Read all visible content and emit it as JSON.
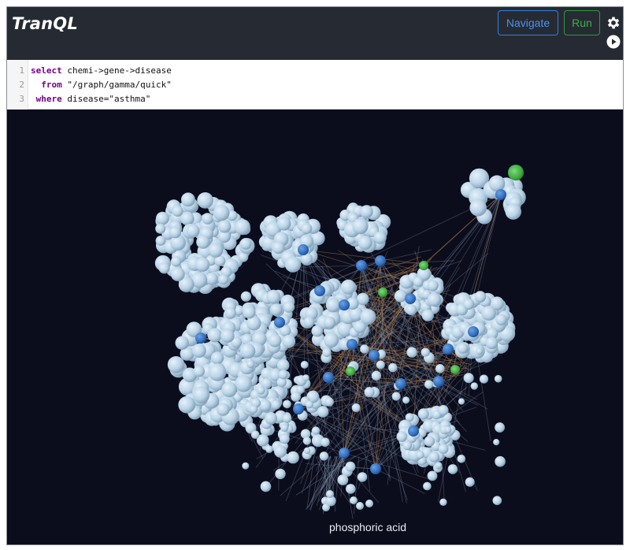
{
  "app": {
    "title": "TranQL"
  },
  "toolbar": {
    "navigate_label": "Navigate",
    "run_label": "Run",
    "settings_icon": "gear-icon",
    "play_icon": "play-icon"
  },
  "editor": {
    "lines": [
      {
        "num": "1",
        "parts": [
          {
            "kind": "kw",
            "text": "select"
          },
          {
            "kind": "plain",
            "text": " chemi->gene->disease"
          }
        ]
      },
      {
        "num": "2",
        "parts": [
          {
            "kind": "plain",
            "text": "  "
          },
          {
            "kind": "kw",
            "text": "from"
          },
          {
            "kind": "plain",
            "text": " \"/graph/gamma/quick\""
          }
        ]
      },
      {
        "num": "3",
        "parts": [
          {
            "kind": "plain",
            "text": " "
          },
          {
            "kind": "kw",
            "text": "where"
          },
          {
            "kind": "plain",
            "text": " disease=\"asthma\""
          }
        ]
      }
    ]
  },
  "graph": {
    "hover_label": "phosphoric acid",
    "colors": {
      "background": "#0b0d1c",
      "chemical_node": "#b9d3e6",
      "gene_node": "#2f6fc0",
      "disease_node": "#3aa83a",
      "edge_gene": "#8a9bb4",
      "edge_disease": "#c88a4a"
    }
  }
}
